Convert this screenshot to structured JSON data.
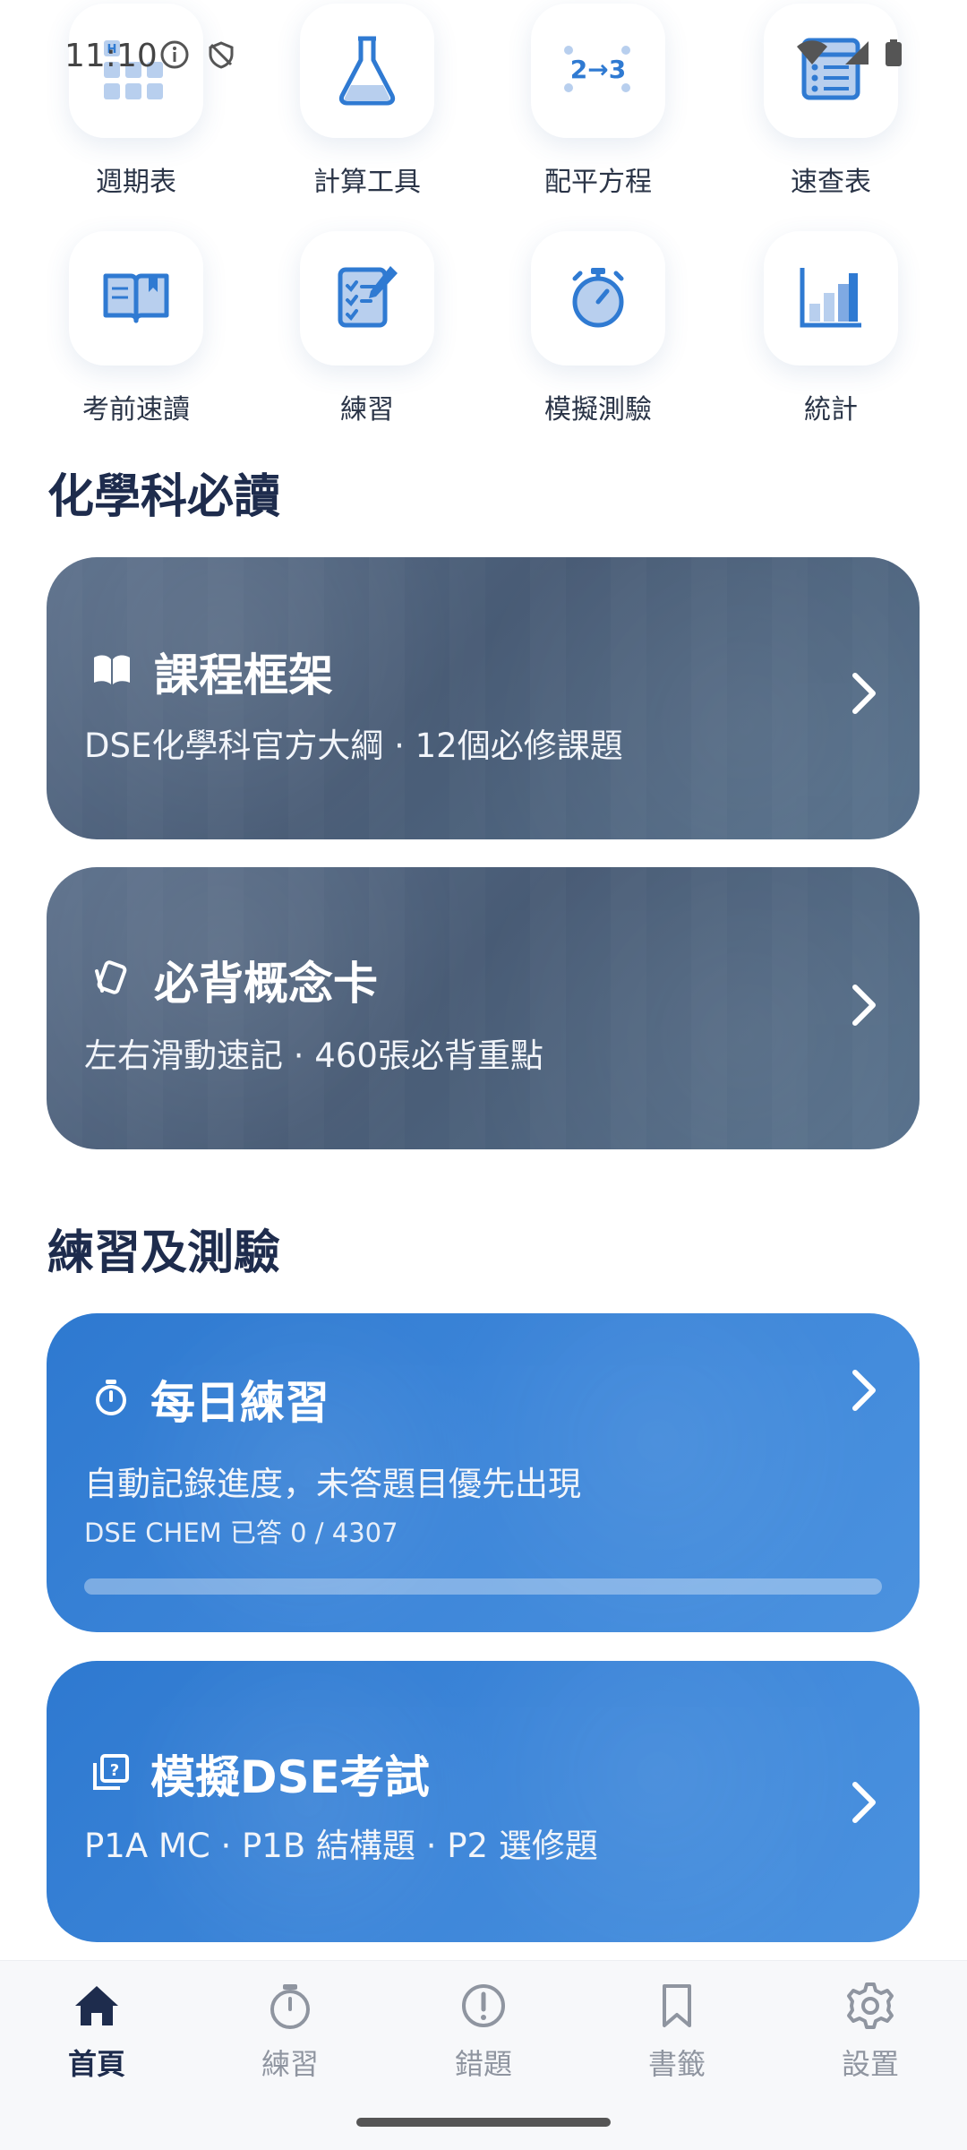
{
  "status_bar": {
    "time": "11:10"
  },
  "tools": [
    {
      "label": "週期表",
      "icon": "periodic-table-icon"
    },
    {
      "label": "計算工具",
      "icon": "flask-icon"
    },
    {
      "label": "配平方程",
      "icon": "balance-equation-icon",
      "icon_text": "2→3"
    },
    {
      "label": "速查表",
      "icon": "cheatsheet-icon"
    },
    {
      "label": "考前速讀",
      "icon": "open-book-icon"
    },
    {
      "label": "練習",
      "icon": "checklist-icon"
    },
    {
      "label": "模擬測驗",
      "icon": "stopwatch-icon"
    },
    {
      "label": "統計",
      "icon": "bar-chart-icon"
    }
  ],
  "sections": {
    "must_read": "化學科必讀",
    "practice": "練習及測驗"
  },
  "cards": {
    "curriculum": {
      "title": "課程框架",
      "subtitle": "DSE化學科官方大綱 · 12個必修課題",
      "icon": "book-icon"
    },
    "flashcards": {
      "title": "必背概念卡",
      "subtitle": "左右滑動速記 · 460張必背重點",
      "icon": "cards-icon"
    },
    "daily": {
      "title": "每日練習",
      "subtitle": "自動記錄進度，未答題目優先出現",
      "meta": "DSE CHEM 已答 0 / 4307",
      "icon": "timer-icon",
      "progress": 0
    },
    "mock": {
      "title": "模擬DSE考試",
      "subtitle": "P1A MC · P1B 結構題 · P2 選修題",
      "icon": "exam-icon"
    }
  },
  "nav": [
    {
      "label": "首頁",
      "icon": "home-icon",
      "active": true
    },
    {
      "label": "練習",
      "icon": "stopwatch-icon",
      "active": false
    },
    {
      "label": "錯題",
      "icon": "alert-icon",
      "active": false
    },
    {
      "label": "書籤",
      "icon": "bookmark-icon",
      "active": false
    },
    {
      "label": "設置",
      "icon": "gear-icon",
      "active": false
    }
  ],
  "colors": {
    "accent": "#2f7ad2",
    "title": "#1e2c4d",
    "nav_inactive": "#8f95a0"
  }
}
